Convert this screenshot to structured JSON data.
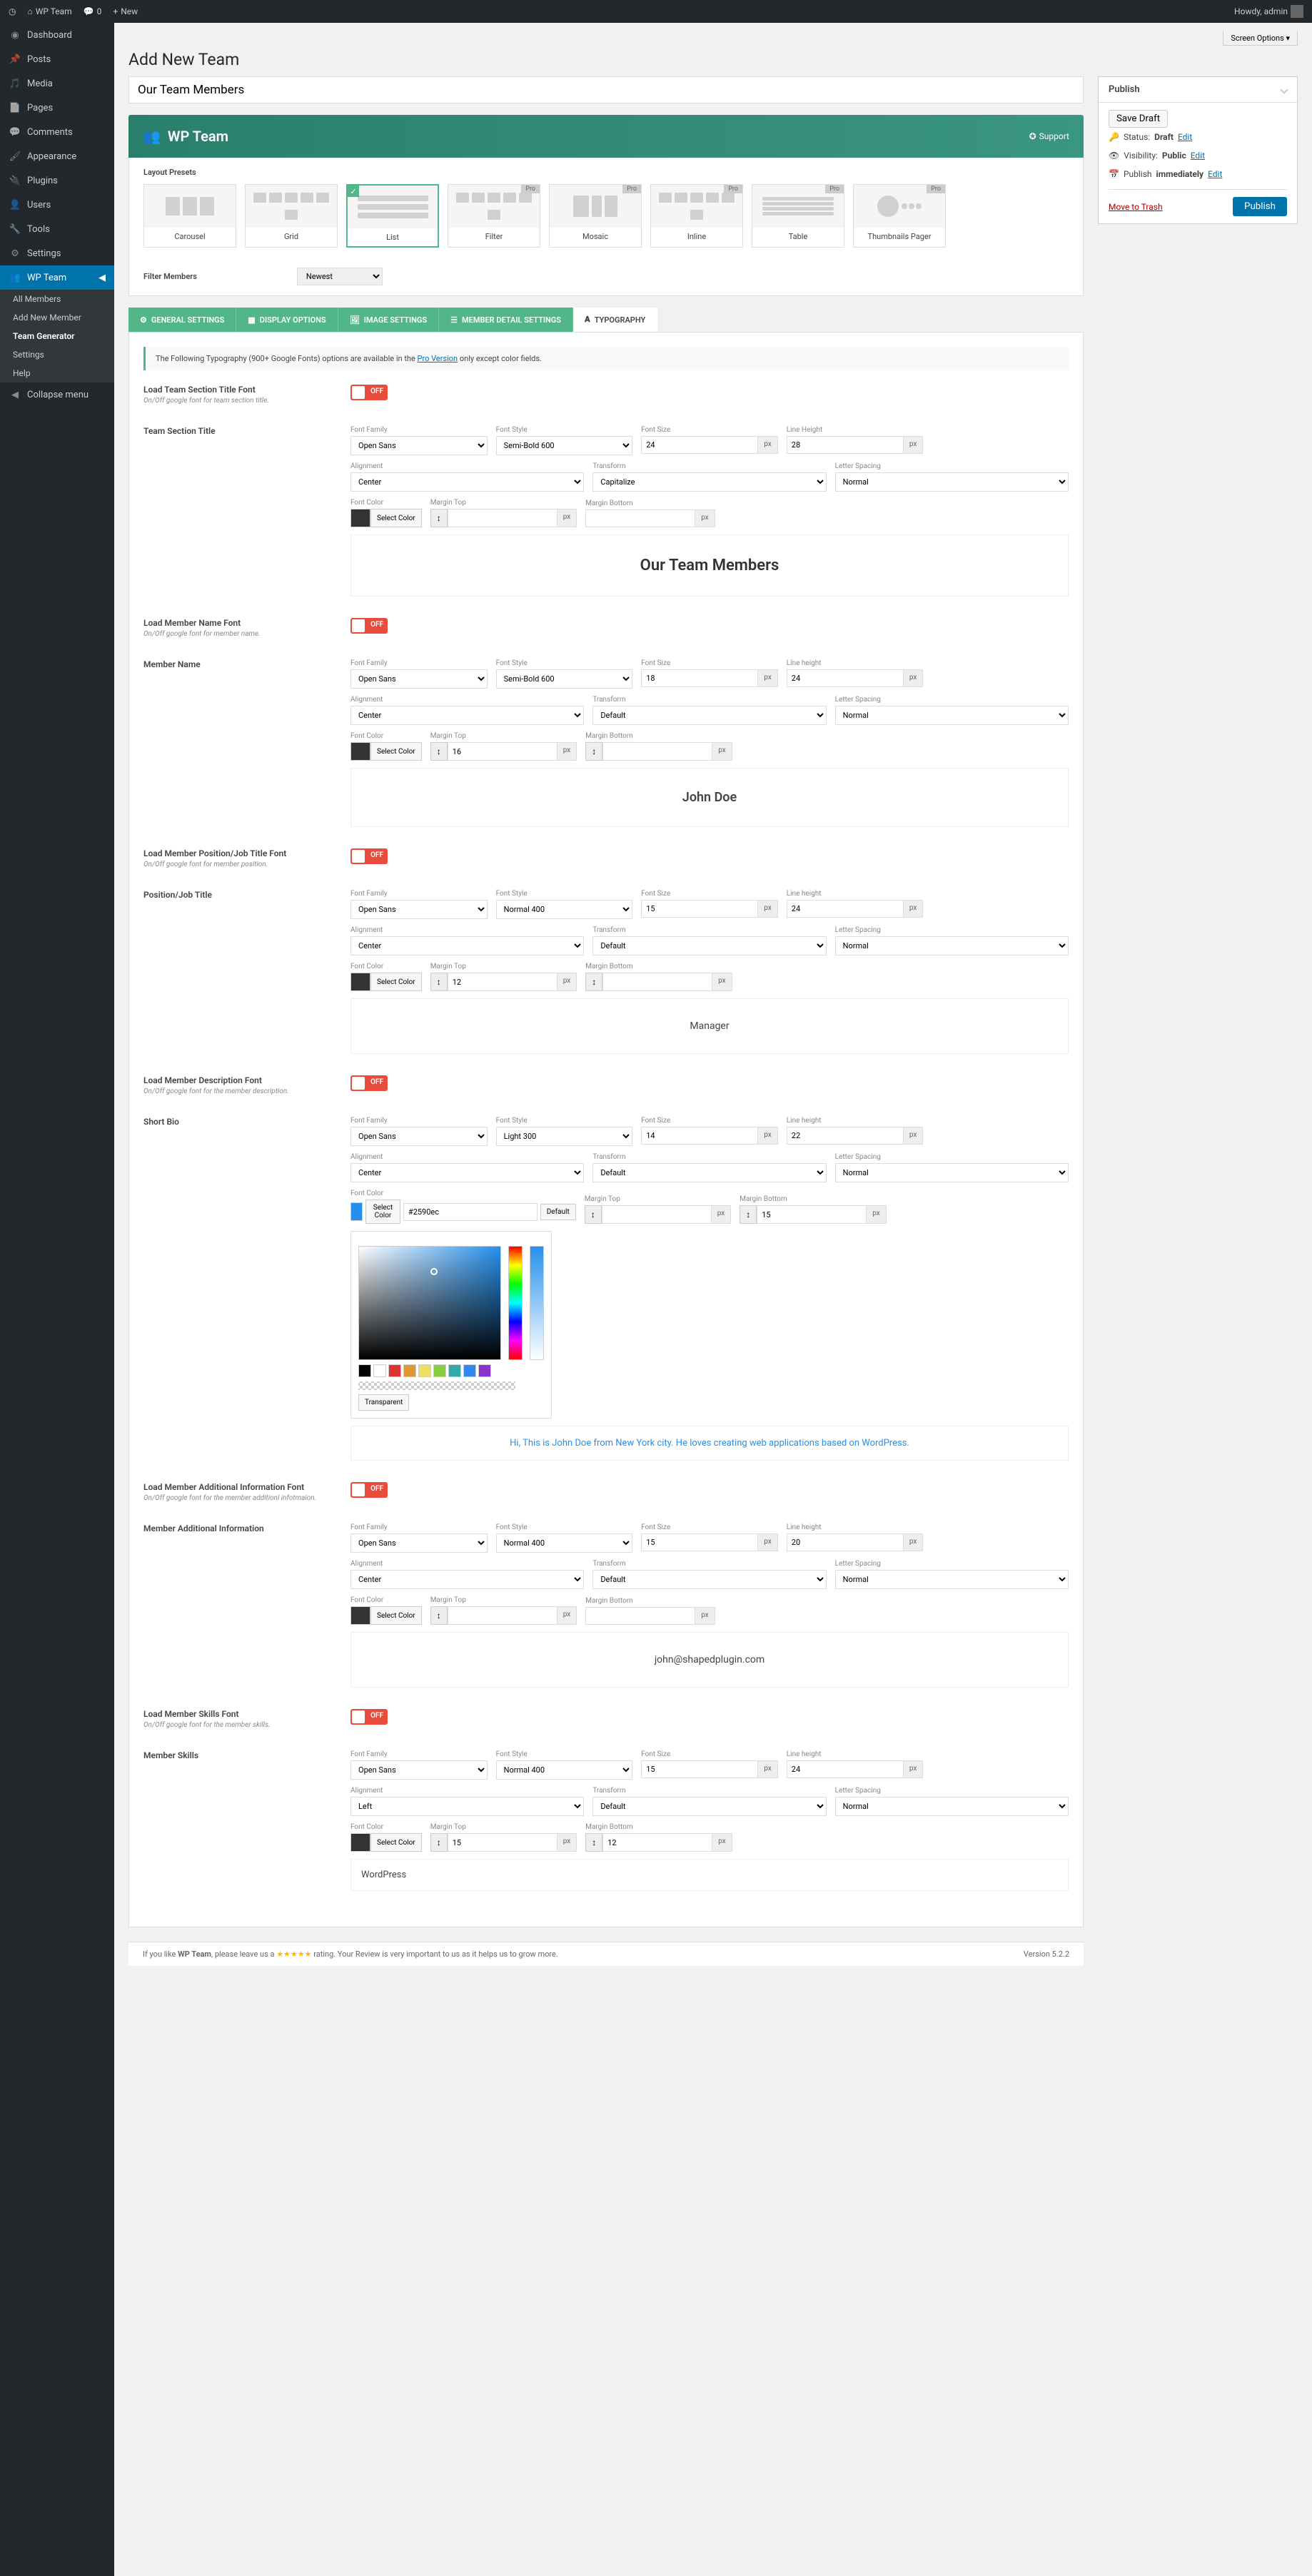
{
  "adminbar": {
    "site": "WP Team",
    "comments": "0",
    "new": "New",
    "howdy": "Howdy, admin"
  },
  "screen_options": "Screen Options",
  "sidebar": {
    "items": [
      "Dashboard",
      "Posts",
      "Media",
      "Pages",
      "Comments",
      "Appearance",
      "Plugins",
      "Users",
      "Tools",
      "Settings",
      "WP Team"
    ],
    "sub": [
      "All Members",
      "Add New Member",
      "Team Generator",
      "Settings",
      "Help"
    ],
    "collapse": "Collapse menu"
  },
  "page_title": "Add New Team",
  "title_field": "Our Team Members",
  "publish": {
    "heading": "Publish",
    "save": "Save Draft",
    "status_lbl": "Status:",
    "status": "Draft",
    "edit": "Edit",
    "vis_lbl": "Visibility:",
    "vis": "Public",
    "pub_lbl": "Publish",
    "pub": "immediately",
    "trash": "Move to Trash",
    "btn": "Publish"
  },
  "banner": {
    "title": "WP Team",
    "support": "Support"
  },
  "presets": {
    "label": "Layout Presets",
    "items": [
      "Carousel",
      "Grid",
      "List",
      "Filter",
      "Mosaic",
      "Inline",
      "Table",
      "Thumbnails Pager"
    ],
    "pro": "Pro"
  },
  "filter": {
    "label": "Filter Members",
    "value": "Newest"
  },
  "tabs": [
    "GENERAL SETTINGS",
    "DISPLAY OPTIONS",
    "IMAGE SETTINGS",
    "MEMBER DETAIL SETTINGS",
    "TYPOGRAPHY"
  ],
  "notice": {
    "pre": "The Following Typography (900+ Google Fonts) options are available in the ",
    "link": "Pro Version",
    "post": " only except color fields."
  },
  "toggle_off": "OFF",
  "sections": [
    {
      "title": "Load Team Section Title Font",
      "desc": "On/Off google font for team section title."
    },
    {
      "title": "Team Section Title"
    },
    {
      "title": "Load Member Name Font",
      "desc": "On/Off google font for member name."
    },
    {
      "title": "Member Name"
    },
    {
      "title": "Load Member Position/Job Title Font",
      "desc": "On/Off google font for member position."
    },
    {
      "title": "Position/Job Title"
    },
    {
      "title": "Load Member Description Font",
      "desc": "On/Off google font for the member description."
    },
    {
      "title": "Short Bio"
    },
    {
      "title": "Load Member Additional Information Font",
      "desc": "On/Off google font for the member additionl infotmaion."
    },
    {
      "title": "Member Additional Information"
    },
    {
      "title": "Load Member Skills Font",
      "desc": "On/Off google font for the member skills."
    },
    {
      "title": "Member Skills"
    }
  ],
  "labels": {
    "ff": "Font Family",
    "fs": "Font Style",
    "fsize": "Font Size",
    "lh": "Line Height",
    "align": "Alignment",
    "trans": "Transform",
    "ls": "Letter Spacing",
    "fc": "Font Color",
    "mt": "Margin Top",
    "mb": "Margin Bottom",
    "lht": "Line height"
  },
  "typo": {
    "section_title": {
      "ff": "Open Sans",
      "fs": "Semi-Bold 600",
      "size": "24",
      "lh": "28",
      "align": "Center",
      "trans": "Capitalize",
      "ls": "Normal",
      "preview": "Our Team Members"
    },
    "member_name": {
      "ff": "Open Sans",
      "fs": "Semi-Bold 600",
      "size": "18",
      "lh": "24",
      "align": "Center",
      "trans": "Default",
      "ls": "Normal",
      "mt": "16",
      "preview": "John Doe"
    },
    "position": {
      "ff": "Open Sans",
      "fs": "Normal 400",
      "size": "15",
      "lh": "24",
      "align": "Center",
      "trans": "Default",
      "ls": "Normal",
      "mt": "12",
      "preview": "Manager"
    },
    "bio": {
      "ff": "Open Sans",
      "fs": "Light 300",
      "size": "14",
      "lh": "22",
      "align": "Center",
      "trans": "Default",
      "ls": "Normal",
      "mb": "15",
      "hex": "#2590ec",
      "preview": "Hi, This is John Doe from New York city. He loves creating web applications based on WordPress."
    },
    "addl": {
      "ff": "Open Sans",
      "fs": "Normal 400",
      "size": "15",
      "lh": "20",
      "align": "Center",
      "trans": "Default",
      "ls": "Normal",
      "preview": "john@shapedplugin.com"
    },
    "skills": {
      "ff": "Open Sans",
      "fs": "Normal 400",
      "size": "15",
      "lh": "24",
      "align": "Left",
      "trans": "Default",
      "ls": "Normal",
      "mt": "15",
      "mb": "12",
      "preview": "WordPress"
    }
  },
  "color": {
    "select": "Select Color",
    "default": "Default",
    "transparent": "Transparent"
  },
  "px": "px",
  "footer": {
    "text1": "If you like ",
    "brand": "WP Team",
    "text2": ", please leave us a ",
    "text3": " rating. Your Review is very important to us as it helps us to grow more.",
    "version": "Version 5.2.2"
  }
}
